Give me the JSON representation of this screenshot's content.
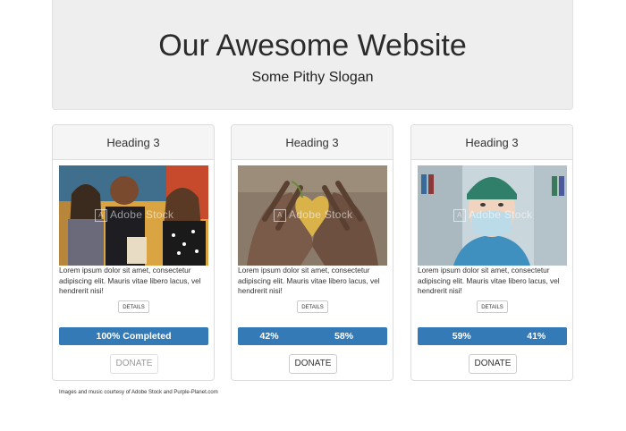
{
  "header": {
    "title": "Our Awesome Website",
    "slogan": "Some Pithy Slogan"
  },
  "cards": [
    {
      "heading": "Heading 3",
      "image_watermark": "Adobe Stock",
      "text": "Lorem ipsum dolor sit amet, consectetur adipiscing elit. Mauris vitae libero lacus, vel hendrerit nisi!",
      "details_label": "DETAILS",
      "progress": [
        {
          "label": "100% Completed",
          "fraction": 1.0
        }
      ],
      "donate_label": "DONATE",
      "donate_enabled": false
    },
    {
      "heading": "Heading 3",
      "image_watermark": "Adobe Stock",
      "text": "Lorem ipsum dolor sit amet, consectetur adipiscing elit. Mauris vitae libero lacus, vel hendrerit nisi!",
      "details_label": "DETAILS",
      "progress": [
        {
          "label": "42%",
          "fraction": 0.42
        },
        {
          "label": "58%",
          "fraction": 0.58
        }
      ],
      "donate_label": "DONATE",
      "donate_enabled": true
    },
    {
      "heading": "Heading 3",
      "image_watermark": "Adobe Stock",
      "text": "Lorem ipsum dolor sit amet, consectetur adipiscing elit. Mauris vitae libero lacus, vel hendrerit nisi!",
      "details_label": "DETAILS",
      "progress": [
        {
          "label": "59%",
          "fraction": 0.59
        },
        {
          "label": "41%",
          "fraction": 0.41
        }
      ],
      "donate_label": "DONATE",
      "donate_enabled": true
    }
  ],
  "footer": {
    "credits": "Images and music courtesy of Adobe Stock and Purple-Planet.com"
  },
  "colors": {
    "progress_bar": "#337ab7",
    "jumbotron_bg": "#eeeeee"
  }
}
